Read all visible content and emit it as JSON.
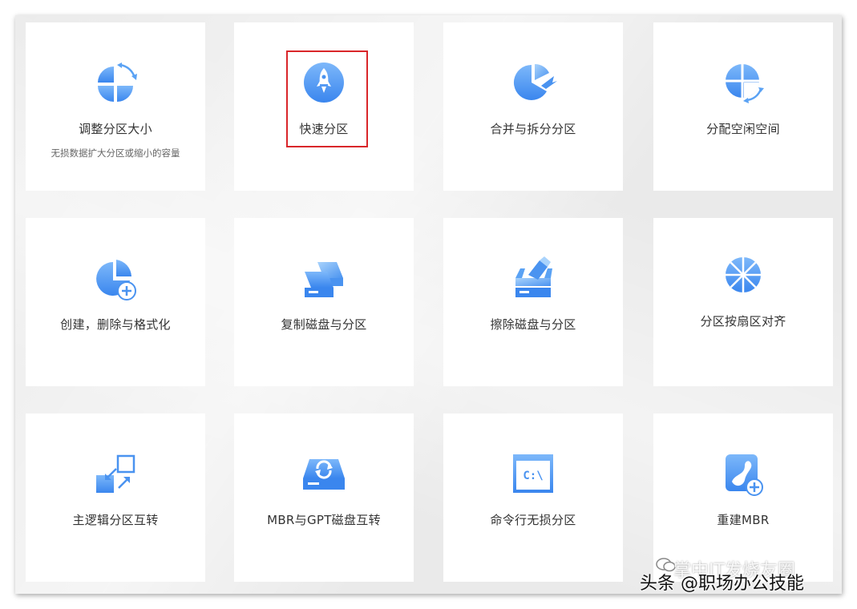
{
  "cards": [
    {
      "title": "调整分区大小",
      "desc": "无损数据扩大分区或缩小的容量",
      "icon": "resize-partition-icon"
    },
    {
      "title": "快速分区",
      "desc": "",
      "icon": "rocket-icon"
    },
    {
      "title": "合并与拆分分区",
      "desc": "",
      "icon": "merge-split-icon"
    },
    {
      "title": "分配空闲空间",
      "desc": "",
      "icon": "allocate-space-icon"
    },
    {
      "title": "创建，删除与格式化",
      "desc": "",
      "icon": "create-partition-icon"
    },
    {
      "title": "复制磁盘与分区",
      "desc": "",
      "icon": "copy-disk-icon"
    },
    {
      "title": "擦除磁盘与分区",
      "desc": "",
      "icon": "wipe-disk-icon"
    },
    {
      "title": "分区按扇区对齐",
      "desc": "",
      "icon": "sector-align-icon"
    },
    {
      "title": "主逻辑分区互转",
      "desc": "",
      "icon": "primary-logical-convert-icon"
    },
    {
      "title": "MBR与GPT磁盘互转",
      "desc": "",
      "icon": "mbr-gpt-convert-icon"
    },
    {
      "title": "命令行无损分区",
      "desc": "",
      "icon": "command-line-icon"
    },
    {
      "title": "重建MBR",
      "desc": "",
      "icon": "rebuild-mbr-icon"
    }
  ],
  "watermark": {
    "front": "头条 @职场办公技能",
    "back": "掌中IT发烧友圈"
  },
  "colors": {
    "accent": "#3c8ff0",
    "accent_light": "#8cc2fb",
    "highlight": "#d9262a"
  }
}
